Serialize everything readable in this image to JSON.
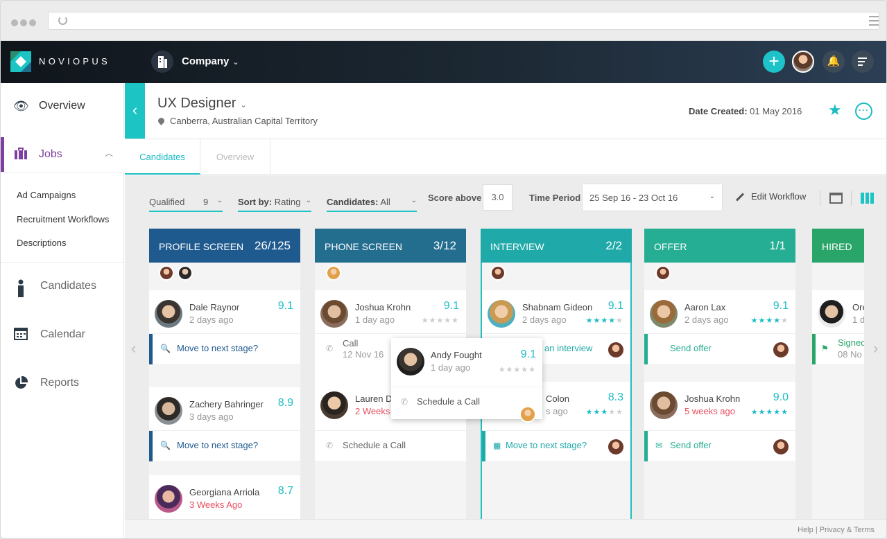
{
  "app": {
    "brand": "NOVIOPUS",
    "company_label": "Company"
  },
  "colors": {
    "accent": "#1cc4c4",
    "jobs_purple": "#7e3fa0",
    "profile_header": "#1f5a8f",
    "phone_header": "#236d8f",
    "interview_header": "#1fa9a9",
    "offer_header": "#26ae95",
    "hired_header": "#2aa56a",
    "red_text": "#e84e5e"
  },
  "sidebar": {
    "items": [
      {
        "label": "Overview",
        "icon": "eye-icon"
      },
      {
        "label": "Jobs",
        "icon": "briefcase-icon"
      },
      {
        "label": "Candidates",
        "icon": "person-icon"
      },
      {
        "label": "Calendar",
        "icon": "calendar-icon"
      },
      {
        "label": "Reports",
        "icon": "pie-chart-icon"
      }
    ],
    "sub_items": [
      "Ad Campaigns",
      "Recruitment Workflows",
      "Descriptions"
    ]
  },
  "job": {
    "title": "UX Designer",
    "location": "Canberra, Australian Capital Territory",
    "date_created_label": "Date Created:",
    "date_created_value": "01 May 2016"
  },
  "tabs": [
    "Candidates",
    "Overview"
  ],
  "filters": {
    "qualified_label": "Qualified",
    "qualified_value": "9",
    "sortby_label": "Sort by:",
    "sortby_value": "Rating",
    "candidates_label": "Candidates:",
    "candidates_value": "All",
    "score_label": "Score above",
    "score_value": "3.0",
    "time_label": "Time Period",
    "time_value": "25 Sep 16 - 23 Oct 16",
    "edit_workflow": "Edit Workflow"
  },
  "columns": [
    {
      "title": "PROFILE SCREEN",
      "count": "26/125",
      "cards": [
        {
          "name": "Dale Raynor",
          "time": "2 days ago",
          "score": "9.1",
          "action": "Move to next stage?"
        },
        {
          "name": "Zachery Bahringer",
          "time": "3 days ago",
          "score": "8.9",
          "action": "Move to next stage?"
        },
        {
          "name": "Georgiana Arriola",
          "time": "3 Weeks Ago",
          "score": "8.7"
        }
      ]
    },
    {
      "title": "PHONE SCREEN",
      "count": "3/12",
      "cards": [
        {
          "name": "Joshua Krohn",
          "time": "1 day ago",
          "score": "9.1",
          "action_title": "Call",
          "action_sub": "12 Nov 16"
        },
        {
          "name": "Lauren Da",
          "time": "2 Weeks A",
          "action": "Schedule a Call"
        }
      ]
    },
    {
      "title": "INTERVIEW",
      "count": "2/2",
      "cards": [
        {
          "name": "Shabnam Gideon",
          "time": "2 days ago",
          "score": "9.1",
          "action": "an interview"
        },
        {
          "name": "Colon",
          "time": "s ago",
          "score": "8.3",
          "action": "Move to next stage?"
        }
      ]
    },
    {
      "title": "OFFER",
      "count": "1/1",
      "cards": [
        {
          "name": "Aaron Lax",
          "time": "2 days ago",
          "score": "9.1",
          "action": "Send offer"
        },
        {
          "name": "Joshua Krohn",
          "time": "5 weeks ago",
          "score": "9.0",
          "action": "Send offer"
        }
      ]
    },
    {
      "title": "HIRED",
      "cards": [
        {
          "name": "Ore",
          "time": "1 d",
          "action": "Signed",
          "action_sub": "08 No"
        }
      ]
    }
  ],
  "popup": {
    "name": "Andy Fought",
    "time": "1 day ago",
    "score": "9.1",
    "action": "Schedule a Call"
  },
  "footer": {
    "help": "Help",
    "sep": "|",
    "privacy": "Privacy & Terms"
  }
}
